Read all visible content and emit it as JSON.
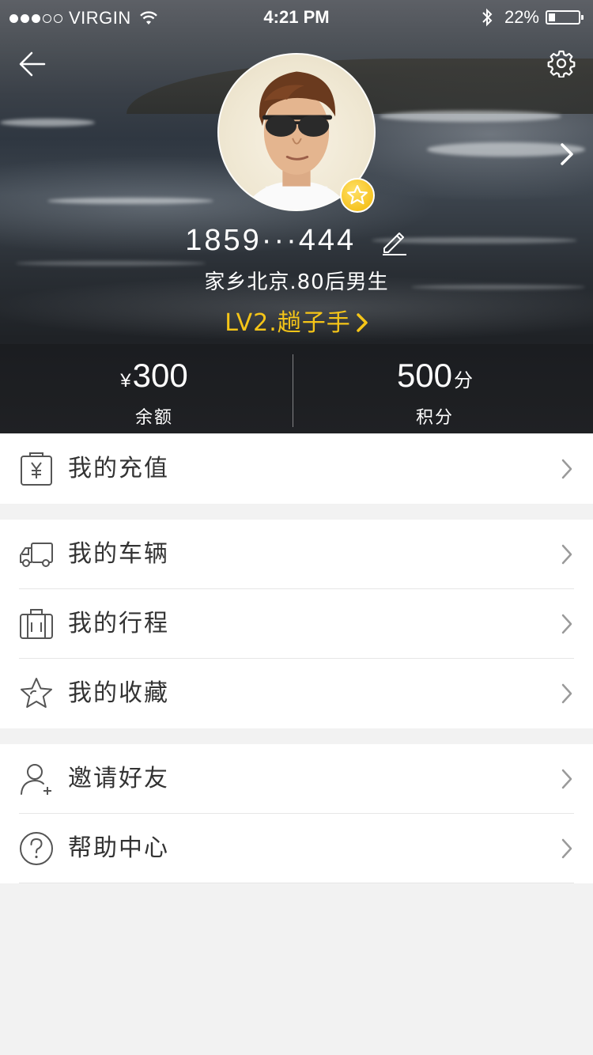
{
  "status_bar": {
    "carrier": "VIRGIN",
    "time": "4:21 PM",
    "battery": "22%",
    "battery_level": 0.22,
    "signal_dots_filled": 3,
    "signal_dots_total": 5
  },
  "profile": {
    "phone": "1859···444",
    "bio": "家乡北京.80后男生",
    "level": "LV2.趟子手"
  },
  "stats": {
    "balance": {
      "currency": "¥",
      "value": "300",
      "label": "余额"
    },
    "points": {
      "value": "500",
      "unit": "分",
      "label": "积分"
    }
  },
  "menu": {
    "groups": [
      {
        "items": [
          {
            "icon": "recharge-icon",
            "label": "我的充值"
          }
        ]
      },
      {
        "items": [
          {
            "icon": "truck-icon",
            "label": "我的车辆"
          },
          {
            "icon": "luggage-icon",
            "label": "我的行程"
          },
          {
            "icon": "star-icon",
            "label": "我的收藏"
          }
        ]
      },
      {
        "items": [
          {
            "icon": "add-friend-icon",
            "label": "邀请好友"
          },
          {
            "icon": "help-icon",
            "label": "帮助中心"
          }
        ]
      }
    ]
  },
  "colors": {
    "accent_gold": "#f5c518",
    "page_background": "#f2f2f2",
    "icon_gray": "#555555",
    "chevron_gray": "#9a9a9a"
  }
}
